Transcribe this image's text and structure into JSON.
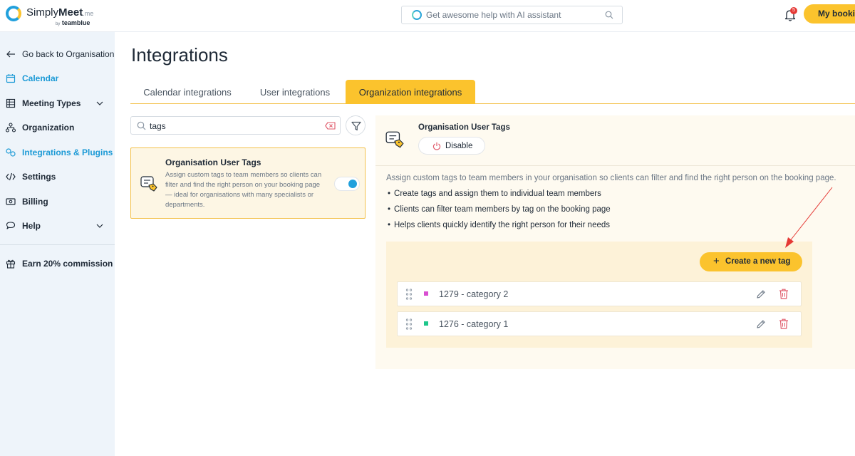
{
  "header": {
    "brand_name_left": "Simply",
    "brand_name_right": "Meet",
    "brand_suffix": ".me",
    "brand_by": "by",
    "brand_company": "teamblue",
    "ai_search_placeholder": "Get awesome help with AI assistant",
    "notifications_count": "5",
    "my_booking_label": "My booking"
  },
  "sidebar": {
    "back_label": "Go back to Organisation",
    "items": [
      {
        "label": "Calendar",
        "icon": "calendar-icon"
      },
      {
        "label": "Meeting Types",
        "icon": "grid-icon"
      },
      {
        "label": "Organization",
        "icon": "org-chart-icon"
      },
      {
        "label": "Integrations & Plugins",
        "icon": "plugins-icon"
      },
      {
        "label": "Settings",
        "icon": "code-icon"
      },
      {
        "label": "Billing",
        "icon": "billing-icon"
      },
      {
        "label": "Help",
        "icon": "chat-icon"
      }
    ],
    "commission_label": "Earn 20% commission"
  },
  "main": {
    "page_title": "Integrations",
    "tabs": [
      {
        "label": "Calendar integrations"
      },
      {
        "label": "User integrations"
      },
      {
        "label": "Organization integrations",
        "active": true
      }
    ],
    "search_value": "tags",
    "card": {
      "title": "Organisation User Tags",
      "description": "Assign custom tags to team members so clients can filter and find the right person on your booking page — ideal for organisations with many specialists or departments.",
      "enabled": true
    },
    "detail": {
      "title": "Organisation User Tags",
      "disable_label": "Disable",
      "description": "Assign custom tags to team members in your organisation so clients can filter and find the right person on the booking page.",
      "bullets": [
        "Create tags and assign them to individual team members",
        "Clients can filter team members by tag on the booking page",
        "Helps clients quickly identify the right person for their needs"
      ],
      "create_tag_label": "Create a new tag",
      "tags": [
        {
          "name": "1279 - category 2",
          "color": "#d94fd1"
        },
        {
          "name": "1276 - category 1",
          "color": "#1ec78b"
        }
      ]
    }
  },
  "colors": {
    "accent": "#fbc32d",
    "brand_blue": "#21a0dc",
    "danger": "#e53935",
    "annotation_arrow": "#e53935"
  }
}
